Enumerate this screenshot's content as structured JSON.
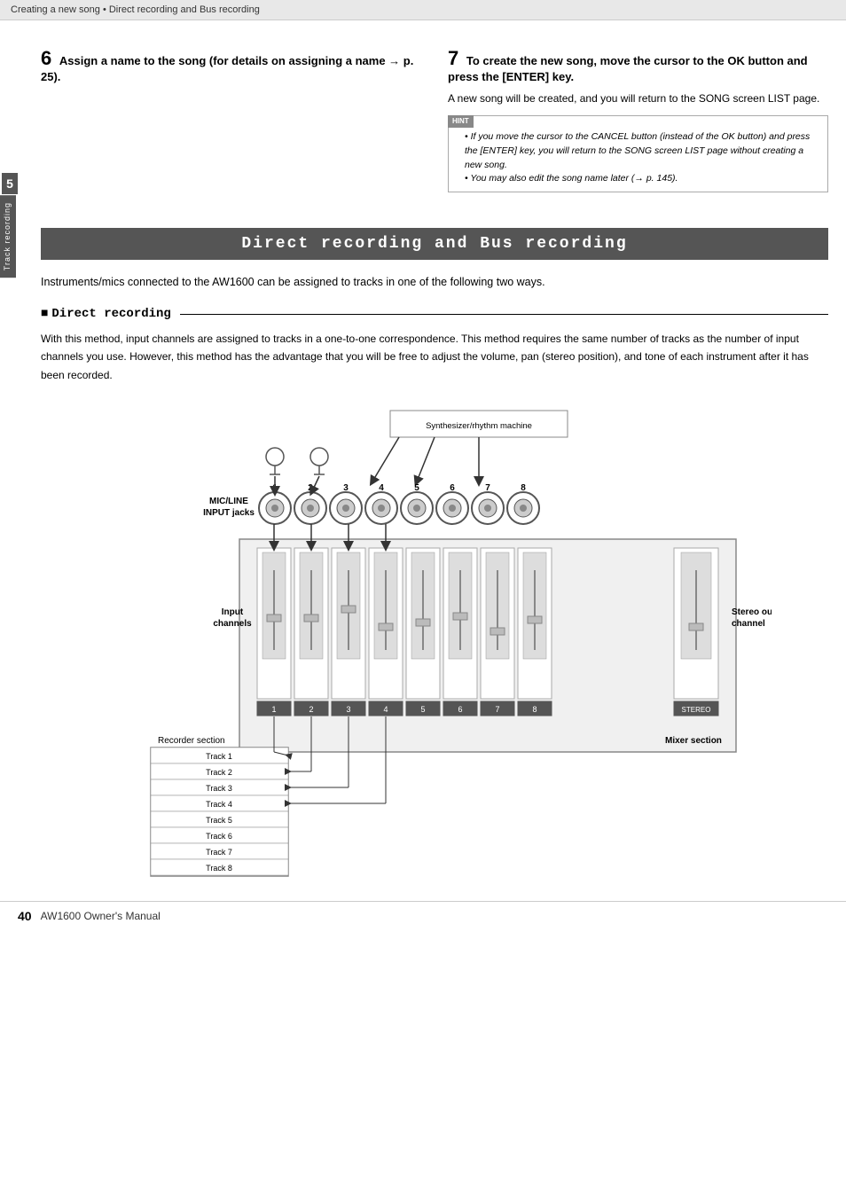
{
  "header": {
    "text": "Creating a new song  •  Direct recording and Bus recording"
  },
  "side_tab": {
    "chapter": "5",
    "label": "Track recording"
  },
  "step6": {
    "number": "6",
    "title": "Assign a name to the song (for details on assigning a name → p. 25)."
  },
  "step7": {
    "number": "7",
    "title": "To create the new song, move the cursor to the OK button and press the [ENTER] key.",
    "body": "A new song will be created, and you will return to the SONG screen LIST page.",
    "hint_label": "HINT",
    "hints": [
      "If you move the cursor to the CANCEL button (instead of the OK button) and press the [ENTER] key, you will return to the SONG screen LIST page without creating a new song.",
      "You may also edit the song name later (→ p. 145)."
    ]
  },
  "section_title": "Direct recording and Bus recording",
  "intro": "Instruments/mics connected to the AW1600 can be assigned to tracks in one of the following two ways.",
  "subsection": {
    "title": "Direct recording",
    "body": "With this method, input channels are assigned to tracks in a one-to-one correspondence.\nThis method requires the same number of tracks as the number of input channels you use. However, this method has the advantage that you will be free to adjust the volume, pan (stereo position), and tone of each instrument after it has been recorded."
  },
  "diagram": {
    "synth_label": "Synthesizer/rhythm machine",
    "mic_line_label": "MIC/LINE\nINPUT jacks",
    "input_channels_label": "Input\nchannels",
    "stereo_output_label": "Stereo output\nchannel",
    "recorder_section_label": "Recorder section",
    "mixer_section_label": "Mixer section",
    "tracks": [
      "Track 1",
      "Track 2",
      "Track 3",
      "Track 4",
      "Track 5",
      "Track 6",
      "Track 7",
      "Track 8"
    ],
    "channel_numbers": [
      "1",
      "2",
      "3",
      "4",
      "5",
      "6",
      "7",
      "8"
    ],
    "stereo_label": "STEREO"
  },
  "footer": {
    "page_number": "40",
    "title": "AW1600  Owner's Manual"
  }
}
